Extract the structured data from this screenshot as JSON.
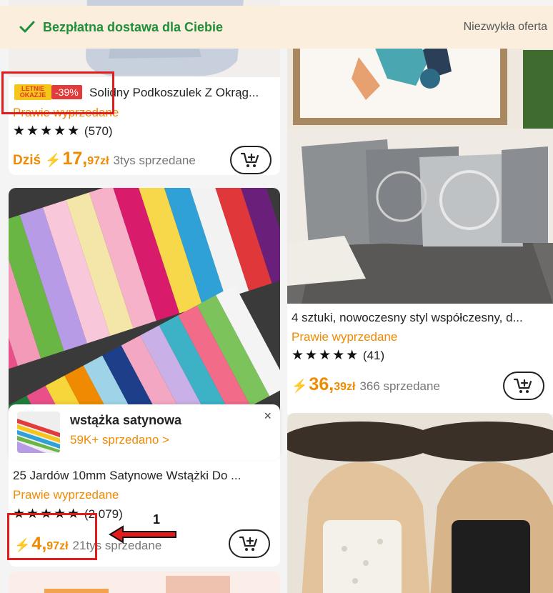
{
  "banner": {
    "title": "Bezpłatna dostawa dla Ciebie",
    "right_link": "Niezwykła oferta"
  },
  "products": {
    "p1": {
      "badge_left": "LETNIE OKAZJE",
      "badge_discount": "-39%",
      "title": "Solidny Podkoszulek Z Okrąg...",
      "status": "Prawie wyprzedane",
      "stars": "★★★★★",
      "reviews": "(570)",
      "price_prefix": "Dziś",
      "price_int": "17,",
      "price_dec": "97zł",
      "sold": "3tys sprzedane"
    },
    "p2": {
      "title": "4 sztuki, nowoczesny styl współczesny, d...",
      "status": "Prawie wyprzedane",
      "stars": "★★★★★",
      "reviews": "(41)",
      "price_int": "36,",
      "price_dec": "39zł",
      "sold": "366 sprzedane"
    },
    "p3": {
      "popup_title": "wstążka satynowa",
      "popup_sub": "59K+ sprzedano >",
      "title": "25 Jardów 10mm Satynowe Wstążki Do ...",
      "status": "Prawie wyprzedane",
      "stars": "★★★★★",
      "reviews": "(2 079)",
      "price_int": "4,",
      "price_dec": "97zł",
      "sold": "21tys sprzedane"
    }
  },
  "annotation": {
    "number": "1"
  },
  "icons": {
    "bolt": "⚡",
    "close": "×"
  },
  "colors": {
    "accent_orange": "#f08a00",
    "banner_green": "#1f8f3a",
    "discount_red": "#e23b3b",
    "annotation_red": "#e21c1c"
  }
}
